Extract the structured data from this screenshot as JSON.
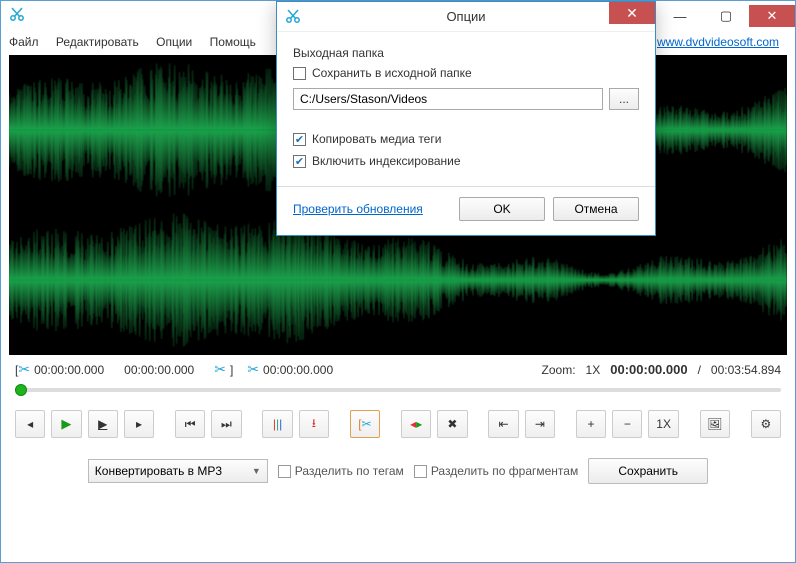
{
  "main_window": {
    "link": "www.dvdvideosoft.com",
    "menu": {
      "file": "Файл",
      "edit": "Редактировать",
      "options": "Опции",
      "help": "Помощь"
    }
  },
  "time": {
    "sel_start": "00:00:00.000",
    "sel_end": "00:00:00.000",
    "cursor": "00:00:00.000",
    "zoom_label": "Zoom:",
    "zoom_value": "1X",
    "current": "00:00:00.000",
    "sep": "/",
    "total": "00:03:54.894"
  },
  "toolbar": {
    "zoom_reset": "1X"
  },
  "bottom": {
    "convert_label": "Конвертировать в MP3",
    "split_tags": "Разделить по тегам",
    "split_fragments": "Разделить по фрагментам",
    "save": "Сохранить"
  },
  "dialog": {
    "title": "Опции",
    "out_folder_label": "Выходная папка",
    "save_in_source": "Сохранить в исходной папке",
    "path": "C:/Users/Stason/Videos",
    "browse": "...",
    "copy_tags": "Копировать медиа теги",
    "enable_indexing": "Включить индексирование",
    "check_updates": "Проверить обновления",
    "ok": "OK",
    "cancel": "Отмена",
    "save_in_source_checked": false,
    "copy_tags_checked": true,
    "enable_indexing_checked": true
  }
}
